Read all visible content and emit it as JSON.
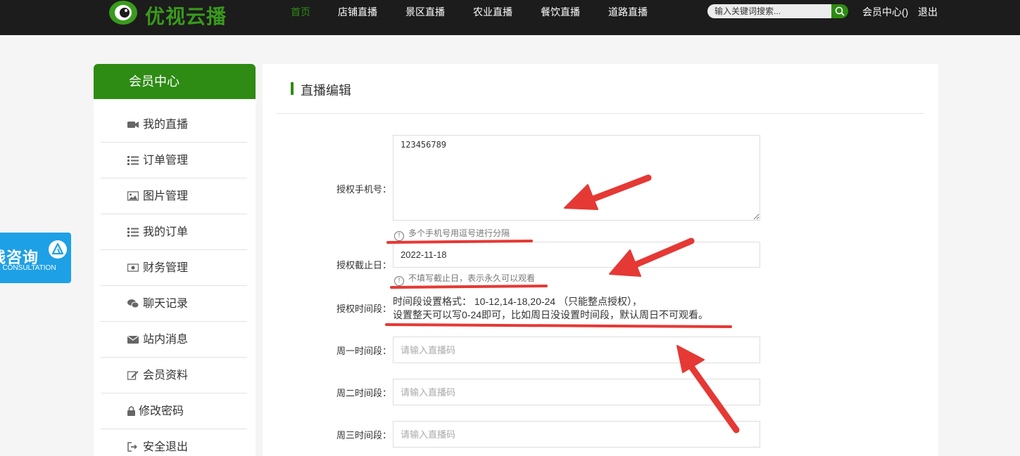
{
  "header": {
    "logo_text": "优视云播",
    "nav": [
      {
        "label": "首页",
        "active": true
      },
      {
        "label": "店铺直播",
        "active": false
      },
      {
        "label": "景区直播",
        "active": false
      },
      {
        "label": "农业直播",
        "active": false
      },
      {
        "label": "餐饮直播",
        "active": false
      },
      {
        "label": "道路直播",
        "active": false
      }
    ],
    "search_placeholder": "输入关键词搜索...",
    "member_center": "会员中心()",
    "logout": "退出"
  },
  "consult": {
    "title": "线咨询",
    "subtitle": "E CONSULTATION"
  },
  "sidebar": {
    "title": "会员中心",
    "items": [
      {
        "label": "我的直播",
        "icon": "video-icon"
      },
      {
        "label": "订单管理",
        "icon": "list-icon"
      },
      {
        "label": "图片管理",
        "icon": "image-icon"
      },
      {
        "label": "我的订单",
        "icon": "list-icon"
      },
      {
        "label": "财务管理",
        "icon": "money-icon"
      },
      {
        "label": "聊天记录",
        "icon": "chat-icon"
      },
      {
        "label": "站内消息",
        "icon": "envelope-icon"
      },
      {
        "label": "会员资料",
        "icon": "edit-icon"
      },
      {
        "label": "修改密码",
        "icon": "lock-icon"
      },
      {
        "label": "安全退出",
        "icon": "signout-icon"
      }
    ]
  },
  "main": {
    "title": "直播编辑",
    "phone": {
      "label": "授权手机号：",
      "value": "123456789",
      "hint": "多个手机号用逗号进行分隔"
    },
    "deadline": {
      "label": "授权截止日：",
      "value": "2022-11-18",
      "hint": "不填写截止日，表示永久可以观看"
    },
    "timeslot": {
      "label": "授权时间段：",
      "line1": "时间段设置格式： 10-12,14-18,20-24 （只能整点授权），",
      "line2": "设置整天可以写0-24即可，比如周日没设置时间段，默认周日不可观看。"
    },
    "days": [
      {
        "label": "周一时间段：",
        "placeholder": "请输入直播码"
      },
      {
        "label": "周二时间段：",
        "placeholder": "请输入直播码"
      },
      {
        "label": "周三时间段：",
        "placeholder": "请输入直播码"
      }
    ]
  },
  "colors": {
    "brand_green": "#2e8b14",
    "topbar": "#1c1c1c",
    "annotation_red": "#e53935",
    "consult_blue": "#1ea0e6"
  }
}
